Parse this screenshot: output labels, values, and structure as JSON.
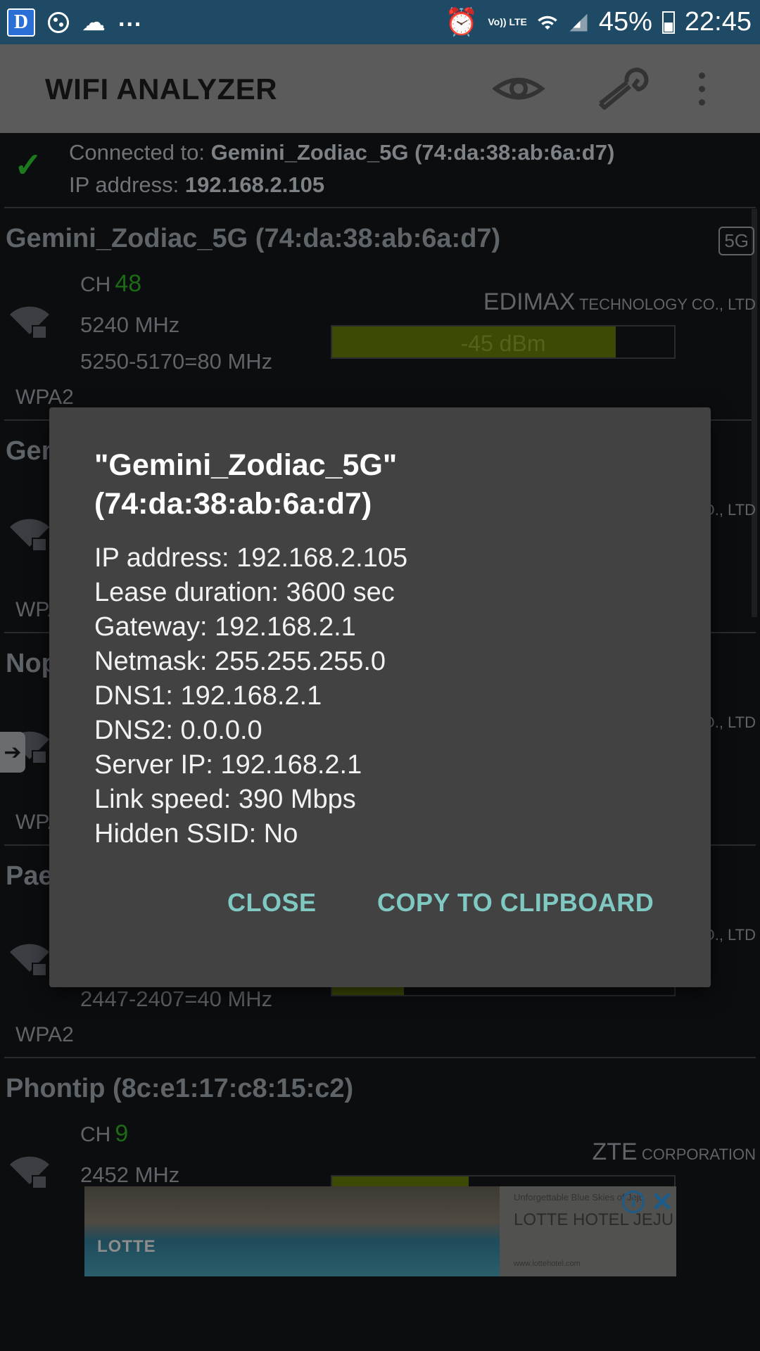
{
  "status_bar": {
    "app_badge": "D",
    "overflow": "...",
    "network": "Vo)) LTE",
    "battery": "45%",
    "time": "22:45"
  },
  "toolbar": {
    "title": "WIFI ANALYZER",
    "icons": [
      "eye-icon",
      "wrench-icon",
      "overflow-menu-icon"
    ]
  },
  "connection": {
    "prefix": "Connected to: ",
    "ssid_bssid": "Gemini_Zodiac_5G (74:da:38:ab:6a:d7)",
    "ip_prefix": "IP address: ",
    "ip": "192.168.2.105"
  },
  "access_points": [
    {
      "title": "Gemini_Zodiac_5G (74:da:38:ab:6a:d7)",
      "band_badge": "5G",
      "ch_label": "CH",
      "channel": "48",
      "frequency": "5240 MHz",
      "width": "5250-5170=80 MHz",
      "security": "WPA2",
      "vendor_big": "EDIMAX",
      "vendor_small": " TECHNOLOGY CO., LTD",
      "signal": "-45 dBm",
      "signal_fraction": 0.83
    },
    {
      "title": "Gem",
      "security": "WPA",
      "vendor_small": "O., LTD"
    },
    {
      "title": "Nop",
      "security": "WPA",
      "vendor_small": "O., LTD"
    },
    {
      "title": "Pae",
      "security": "WPA2",
      "width": "2447-2407=40 MHz",
      "vendor_small": "O., LTD",
      "signal_fraction": 0.21
    },
    {
      "title": "Phontip (8c:e1:17:c8:15:c2)",
      "ch_label": "CH",
      "channel": "9",
      "frequency": "2452 MHz",
      "vendor_big": "ZTE",
      "vendor_small": " CORPORATION",
      "signal_fraction": 0.4
    }
  ],
  "dialog": {
    "title": "\"Gemini_Zodiac_5G\"(74:da:38:ab:6a:d7)",
    "lines": [
      "IP address: 192.168.2.105",
      "Lease duration: 3600 sec",
      "Gateway: 192.168.2.1",
      "Netmask: 255.255.255.0",
      "DNS1: 192.168.2.1",
      "DNS2: 0.0.0.0",
      "Server IP: 192.168.2.1",
      "Link speed: 390 Mbps",
      "Hidden SSID: No"
    ],
    "close_label": "CLOSE",
    "copy_label": "COPY TO CLIPBOARD"
  },
  "ad": {
    "logo": "LOTTE",
    "tagline": "Unforgettable Blue Skies of Jeju",
    "name": "LOTTE HOTEL JEJU",
    "url": "www.lottehotel.com",
    "info_icon": "info-icon",
    "close_icon": "close-icon"
  },
  "colors": {
    "status_bar": "#1e4a66",
    "toolbar_dim": "#5b5b5b",
    "dialog_bg": "#424242",
    "dialog_button": "#7fc9c2",
    "channel_green": "#1d6a14",
    "signal_fill": "#3c4a06"
  }
}
